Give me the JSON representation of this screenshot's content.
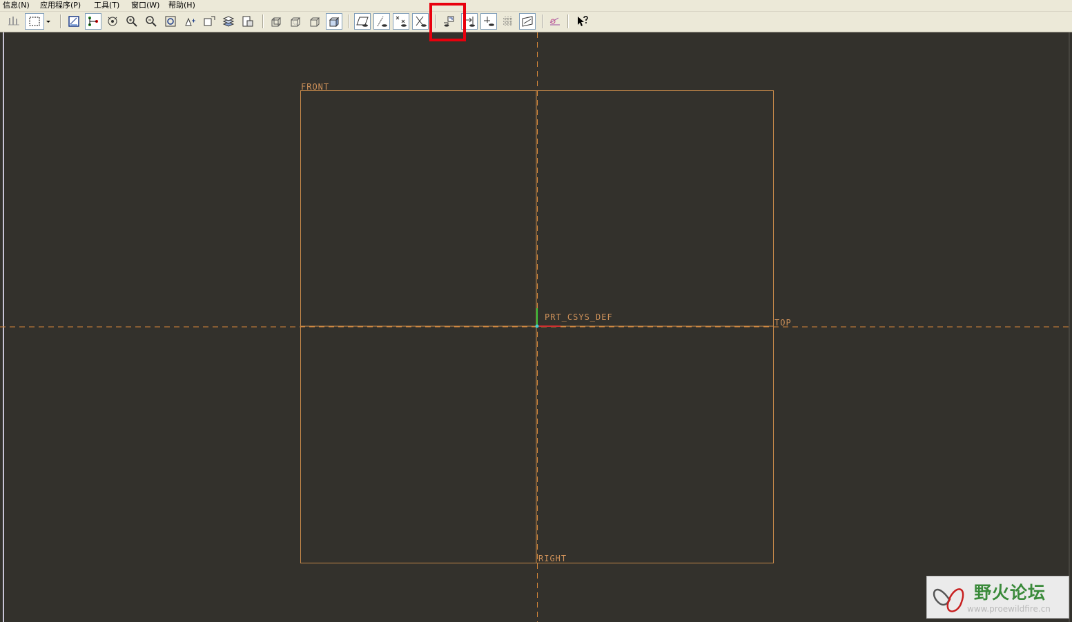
{
  "menu": {
    "items": [
      "信息(N)",
      "应用程序(P)",
      "工具(T)",
      "窗口(W)",
      "帮助(H)"
    ]
  },
  "toolbar": {
    "buttons": [
      "filter-icon",
      "box-select-icon",
      "dropdown-arrow-icon",
      "repaint-icon",
      "spin-center-icon",
      "orient-mode-icon",
      "zoom-in-icon",
      "zoom-out-icon",
      "refit-icon",
      "view-normal-icon",
      "saved-views-icon",
      "layers-icon",
      "view-manager-icon",
      "wireframe-icon",
      "hidden-line-icon",
      "no-hidden-icon",
      "shading-icon",
      "datum-planes-icon",
      "datum-axes-icon",
      "datum-points-icon",
      "coordinate-systems-icon",
      "constraints-display-icon",
      "dimensions-display-icon",
      "vertex-display-icon",
      "grid-display-icon",
      "sketch-view-icon",
      "sketcher-diagnostics-icon",
      "context-help-icon"
    ],
    "highlighted_button": "constraints-display-icon"
  },
  "canvas": {
    "datum_front": "FRONT",
    "datum_top": "TOP",
    "datum_right": "RIGHT",
    "csys_label": "PRT_CSYS_DEF",
    "background_color": "#33312c",
    "datum_color": "#c98a4a"
  },
  "watermark": {
    "title": "野火论坛",
    "url": "www.proewildfire.cn"
  }
}
